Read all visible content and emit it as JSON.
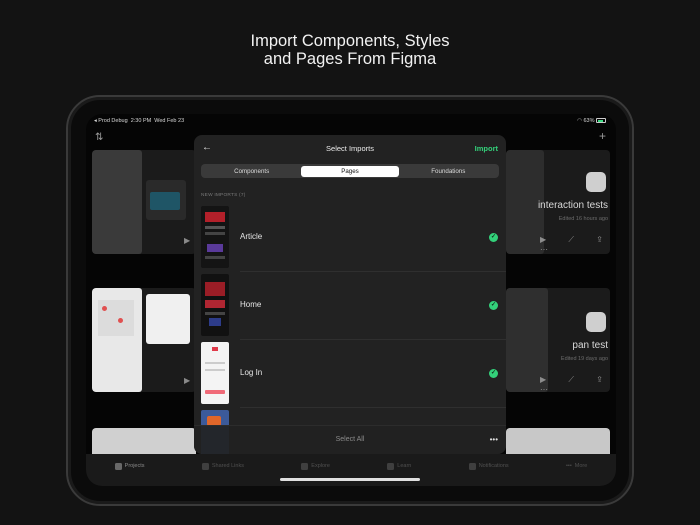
{
  "headline": {
    "line1": "Import Components, Styles",
    "line2": "and Pages From Figma"
  },
  "status_bar": {
    "carrier": "◂ Prod Debug",
    "time": "2:30 PM",
    "date": "Wed Feb 23",
    "battery": "63%"
  },
  "background_projects": [
    {
      "title": "interaction tests",
      "subtitle": "Edited 16 hours ago"
    },
    {
      "title": "pan test",
      "subtitle": "Edited 19 days ago"
    }
  ],
  "modal": {
    "back_icon": "arrow-left-icon",
    "title": "Select Imports",
    "import_label": "Import",
    "tabs": [
      {
        "label": "Components",
        "active": false
      },
      {
        "label": "Pages",
        "active": true
      },
      {
        "label": "Foundations",
        "active": false
      }
    ],
    "section_header": "NEW IMPORTS (7)",
    "items": [
      {
        "label": "Article",
        "selected": true
      },
      {
        "label": "Home",
        "selected": true
      },
      {
        "label": "Log In",
        "selected": true
      },
      {
        "label": "",
        "selected": false
      }
    ],
    "select_all_label": "Select All",
    "more_icon": "ellipsis-icon"
  },
  "tab_bar": [
    {
      "label": "Projects",
      "active": true
    },
    {
      "label": "Shared Links",
      "active": false
    },
    {
      "label": "Explore",
      "active": false
    },
    {
      "label": "Learn",
      "active": false
    },
    {
      "label": "Notifications",
      "active": false
    },
    {
      "label": "More",
      "active": false
    }
  ],
  "colors": {
    "accent": "#33d17a",
    "background": "#131313",
    "modal": "#222222"
  }
}
